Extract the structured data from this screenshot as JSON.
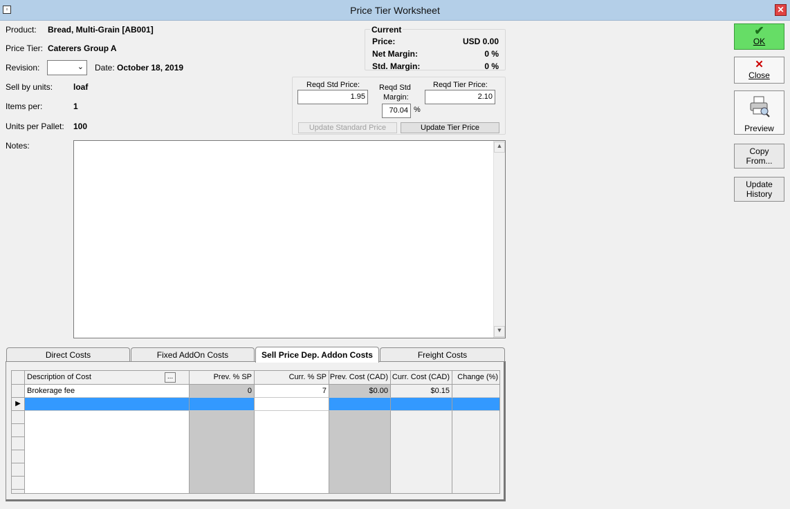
{
  "window": {
    "title": "Price Tier Worksheet",
    "close_glyph": "✕"
  },
  "product": {
    "label": "Product:",
    "value": "Bread, Multi-Grain [AB001]"
  },
  "price_tier": {
    "label": "Price Tier:",
    "value": "Caterers Group A"
  },
  "revision": {
    "label": "Revision:",
    "value": ""
  },
  "date": {
    "label": "Date:",
    "value": "October 18, 2019"
  },
  "sell_by_units": {
    "label": "Sell by units:",
    "value": "loaf"
  },
  "items_per": {
    "label": "Items per:",
    "value": "1"
  },
  "units_per_pallet": {
    "label": "Units per Pallet:",
    "value": "100"
  },
  "notes": {
    "label": "Notes:",
    "value": ""
  },
  "current": {
    "heading": "Current",
    "price_label": "Price:",
    "price_value": "USD 0.00",
    "net_margin_label": "Net Margin:",
    "net_margin_value": "0 %",
    "std_margin_label": "Std. Margin:",
    "std_margin_value": "0 %"
  },
  "reqd": {
    "std_price_label": "Reqd Std Price:",
    "std_price_value": "1.95",
    "std_margin_label_1": "Reqd Std",
    "std_margin_label_2": "Margin:",
    "std_margin_value": "70.04",
    "percent_sign": "%",
    "tier_price_label": "Reqd Tier Price:",
    "tier_price_value": "2.10",
    "update_standard_label": "Update Standard Price",
    "update_tier_label": "Update Tier Price"
  },
  "side_buttons": {
    "ok_label": "OK",
    "close_label": "Close",
    "preview_label": "Preview",
    "copy_from_line1": "Copy",
    "copy_from_line2": "From...",
    "update_history_line1": "Update",
    "update_history_line2": "History"
  },
  "tabs": [
    {
      "label": "Direct Costs",
      "active": false
    },
    {
      "label": "Fixed AddOn Costs",
      "active": false
    },
    {
      "label": "Sell Price Dep. Addon Costs",
      "active": true
    },
    {
      "label": "Freight Costs",
      "active": false
    }
  ],
  "grid": {
    "columns": [
      "Description of Cost",
      "Prev. % SP",
      "Curr. % SP",
      "Prev. Cost (CAD)",
      "Curr. Cost (CAD)",
      "Change (%)"
    ],
    "ellipsis_label": "...",
    "rows": [
      [
        "Brokerage fee",
        "0",
        "7",
        "$0.00",
        "$0.15",
        ""
      ]
    ]
  },
  "colors": {
    "titlebar": "#b4cfe8",
    "selected_row": "#3399ff",
    "ok_button": "#66dd66",
    "close_icon": "#cc0000"
  }
}
